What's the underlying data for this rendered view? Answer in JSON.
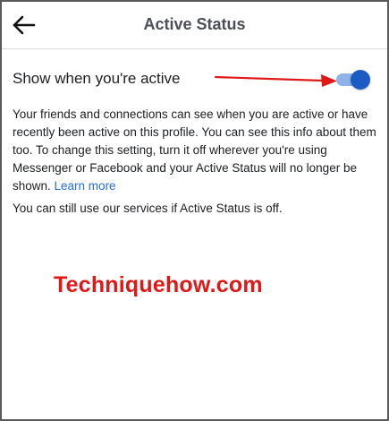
{
  "header": {
    "title": "Active Status",
    "back_icon": "arrow-left-icon"
  },
  "setting": {
    "label": "Show when you're active",
    "toggle_on": true,
    "toggle_track_color": "#8fb2e8",
    "toggle_thumb_color": "#1a5bc4",
    "annotation_arrow_color": "#e01818"
  },
  "description": {
    "text": "Your friends and connections can see when you are active or have recently been active on this profile. You can see this info about them too. To change this setting, turn it off wherever you're using Messenger or Facebook and your Active Status will no longer be shown. ",
    "link_text": "Learn more",
    "link_color": "#216fdb"
  },
  "note": "You can still use our services if Active Status is off.",
  "watermark": {
    "text": "Techniquehow.com",
    "color": "#e01818"
  }
}
